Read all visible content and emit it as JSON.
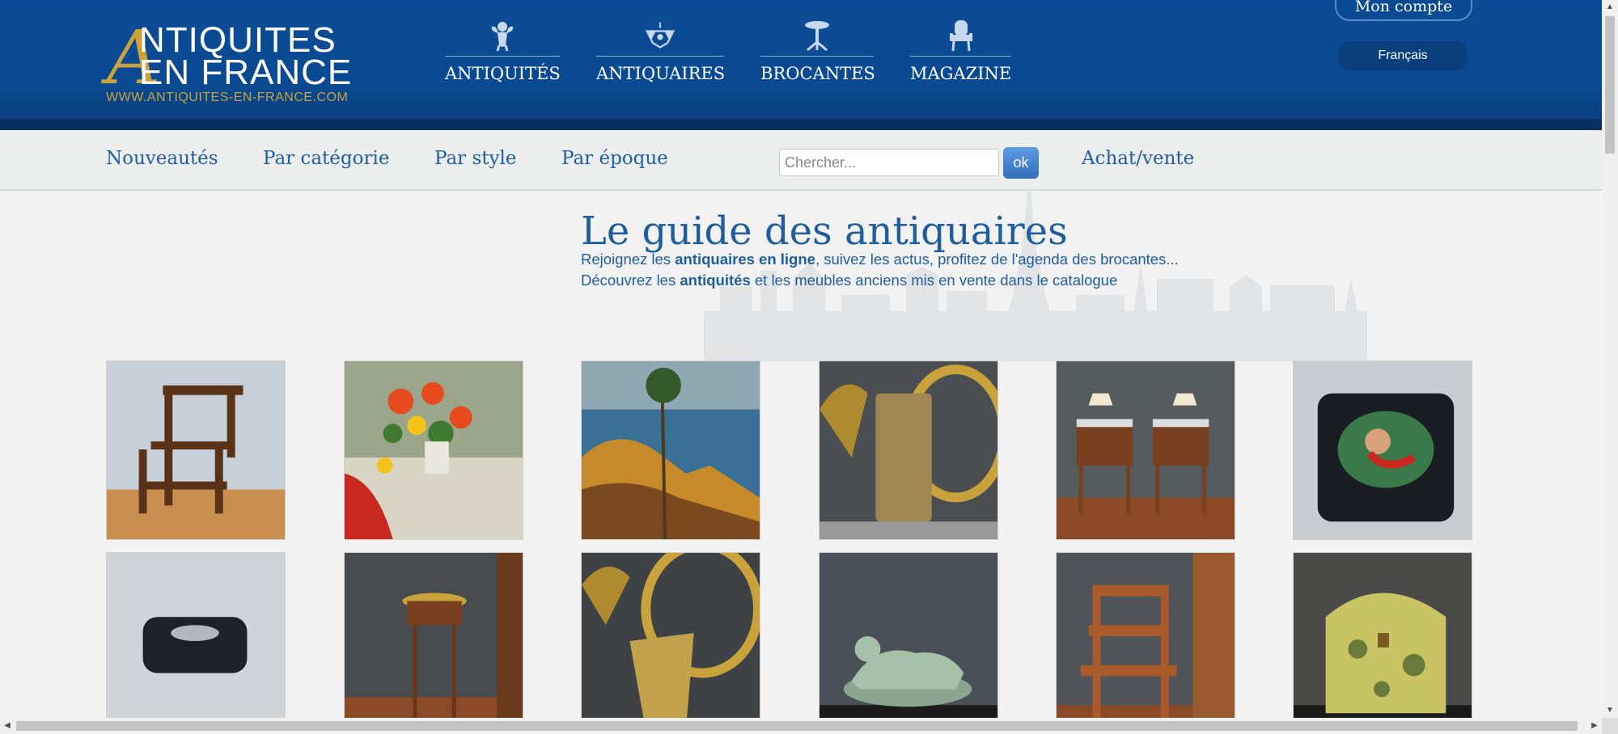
{
  "logo": {
    "letter": "A",
    "line1": "NTIQUITES",
    "line2": "EN FRANCE",
    "url": "WWW.ANTIQUITES-EN-FRANCE.COM"
  },
  "main_nav": [
    {
      "label": "ANTIQUITÉS",
      "icon": "cherub-icon"
    },
    {
      "label": "ANTIQUAIRES",
      "icon": "chandelier-icon"
    },
    {
      "label": "BROCANTES",
      "icon": "pedestal-table-icon"
    },
    {
      "label": "MAGAZINE",
      "icon": "armchair-icon"
    }
  ],
  "account": {
    "label": "Mon compte"
  },
  "language": {
    "label": "Français"
  },
  "sub_nav": {
    "new": "Nouveautés",
    "category": "Par catégorie",
    "style": "Par style",
    "period": "Par époque",
    "buy_sell": "Achat/vente"
  },
  "search": {
    "placeholder": "Chercher...",
    "value": "",
    "button": "ok"
  },
  "hero": {
    "title": "Le guide des antiquaires",
    "line1_pre": "Rejoignez les ",
    "line1_bold": "antiquaires en ligne",
    "line1_post": ", suivez les actus, profitez de l'agenda des brocantes...",
    "line2_pre": "Découvrez les ",
    "line2_bold": "antiquités",
    "line2_post": " et les meubles anciens mis en vente dans le catalogue"
  },
  "products": [
    {
      "subject": "library-step-chair"
    },
    {
      "subject": "still-life-flowers-painting"
    },
    {
      "subject": "coastal-landscape-painting"
    },
    {
      "subject": "brass-umbrella-stand"
    },
    {
      "subject": "pair-of-bedside-tables"
    },
    {
      "subject": "lacquered-portrait-box"
    },
    {
      "subject": "black-lacquer-box"
    },
    {
      "subject": "round-gueridon-table"
    },
    {
      "subject": "brass-umbrella-stand-mirror"
    },
    {
      "subject": "ceramic-dog-sculpture"
    },
    {
      "subject": "library-steps"
    },
    {
      "subject": "painted-dome-chest"
    }
  ],
  "colors": {
    "header_blue": "#0c4c96",
    "header_band": "#082f5e",
    "gold": "#c9a23c",
    "link_blue": "#1f5e9c",
    "page_bg": "#f1f2f1"
  }
}
